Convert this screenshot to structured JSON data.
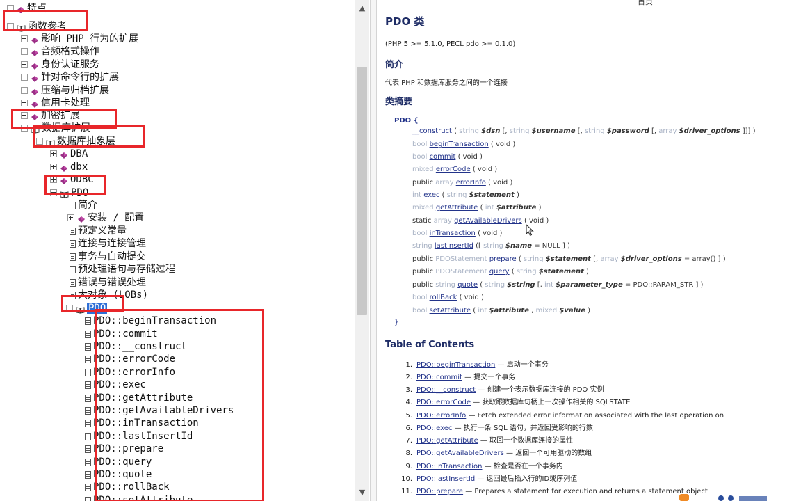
{
  "tree": {
    "nodes": [
      {
        "label": "特点",
        "icon": "book-icon",
        "expander": "plus"
      },
      {
        "label": "函数参考",
        "icon": "open-book-icon",
        "expander": "minus"
      },
      {
        "label": "影响 PHP 行为的扩展",
        "icon": "book-icon",
        "expander": "plus"
      },
      {
        "label": "音频格式操作",
        "icon": "book-icon",
        "expander": "plus"
      },
      {
        "label": "身份认证服务",
        "icon": "book-icon",
        "expander": "plus"
      },
      {
        "label": "针对命令行的扩展",
        "icon": "book-icon",
        "expander": "plus"
      },
      {
        "label": "压缩与归档扩展",
        "icon": "book-icon",
        "expander": "plus"
      },
      {
        "label": "信用卡处理",
        "icon": "book-icon",
        "expander": "plus"
      },
      {
        "label": "加密扩展",
        "icon": "book-icon",
        "expander": "plus"
      },
      {
        "label": "数据库扩展",
        "icon": "open-book-icon",
        "expander": "minus"
      },
      {
        "label": "数据库抽象层",
        "icon": "open-book-icon",
        "expander": "minus"
      },
      {
        "label": "DBA",
        "icon": "book-icon",
        "expander": "plus"
      },
      {
        "label": "dbx",
        "icon": "book-icon",
        "expander": "plus"
      },
      {
        "label": "ODBC",
        "icon": "book-icon",
        "expander": "plus"
      },
      {
        "label": "PDO",
        "icon": "open-book-icon",
        "expander": "minus"
      },
      {
        "label": "简介",
        "icon": "page-icon",
        "expander": ""
      },
      {
        "label": "安装 / 配置",
        "icon": "book-icon",
        "expander": "plus"
      },
      {
        "label": "预定义常量",
        "icon": "page-icon",
        "expander": ""
      },
      {
        "label": "连接与连接管理",
        "icon": "page-icon",
        "expander": ""
      },
      {
        "label": "事务与自动提交",
        "icon": "page-icon",
        "expander": ""
      },
      {
        "label": "预处理语句与存储过程",
        "icon": "page-icon",
        "expander": ""
      },
      {
        "label": "错误与错误处理",
        "icon": "page-icon",
        "expander": ""
      },
      {
        "label": "大对象 (LOBs)",
        "icon": "page-icon",
        "expander": ""
      },
      {
        "label": "PDO",
        "icon": "open-book-icon",
        "expander": "minus",
        "selected": true
      },
      {
        "label": "PDO::beginTransaction",
        "icon": "page-icon",
        "expander": ""
      },
      {
        "label": "PDO::commit",
        "icon": "page-icon",
        "expander": ""
      },
      {
        "label": "PDO::__construct",
        "icon": "page-icon",
        "expander": ""
      },
      {
        "label": "PDO::errorCode",
        "icon": "page-icon",
        "expander": ""
      },
      {
        "label": "PDO::errorInfo",
        "icon": "page-icon",
        "expander": ""
      },
      {
        "label": "PDO::exec",
        "icon": "page-icon",
        "expander": ""
      },
      {
        "label": "PDO::getAttribute",
        "icon": "page-icon",
        "expander": ""
      },
      {
        "label": "PDO::getAvailableDrivers",
        "icon": "page-icon",
        "expander": ""
      },
      {
        "label": "PDO::inTransaction",
        "icon": "page-icon",
        "expander": ""
      },
      {
        "label": "PDO::lastInsertId",
        "icon": "page-icon",
        "expander": ""
      },
      {
        "label": "PDO::prepare",
        "icon": "page-icon",
        "expander": ""
      },
      {
        "label": "PDO::query",
        "icon": "page-icon",
        "expander": ""
      },
      {
        "label": "PDO::quote",
        "icon": "page-icon",
        "expander": ""
      },
      {
        "label": "PDO::rollBack",
        "icon": "page-icon",
        "expander": ""
      },
      {
        "label": "PDO::setAttribute",
        "icon": "page-icon",
        "expander": ""
      }
    ],
    "highlight_color": "#e8262a",
    "selected_color": "#2f6fd6"
  },
  "doc": {
    "top_label": "首页",
    "title": "PDO 类",
    "version": "(PHP 5 >= 5.1.0, PECL pdo >= 0.1.0)",
    "intro_heading": "简介",
    "intro_text": "代表 PHP 和数据库服务之间的一个连接",
    "synopsis_heading": "类摘要",
    "class_open": "PDO {",
    "class_close": "}",
    "methods": [
      {
        "prefix": "",
        "type": "",
        "name": "__construct",
        "params": "( string $dsn [, string $username [, string $password [, array $driver_options ]]] )"
      },
      {
        "prefix": "",
        "type": "bool",
        "name": "beginTransaction",
        "params": "( void )"
      },
      {
        "prefix": "",
        "type": "bool",
        "name": "commit",
        "params": "( void )"
      },
      {
        "prefix": "",
        "type": "mixed",
        "name": "errorCode",
        "params": "( void )"
      },
      {
        "prefix": "public",
        "type": "array",
        "name": "errorInfo",
        "params": "( void )"
      },
      {
        "prefix": "",
        "type": "int",
        "name": "exec",
        "params": "( string $statement )"
      },
      {
        "prefix": "",
        "type": "mixed",
        "name": "getAttribute",
        "params": "( int $attribute )"
      },
      {
        "prefix": "static",
        "type": "array",
        "name": "getAvailableDrivers",
        "params": "( void )"
      },
      {
        "prefix": "",
        "type": "bool",
        "name": "inTransaction",
        "params": "( void )"
      },
      {
        "prefix": "",
        "type": "string",
        "name": "lastInsertId",
        "params": "([ string $name = NULL ] )"
      },
      {
        "prefix": "public",
        "type": "PDOStatement",
        "name": "prepare",
        "params": "( string $statement [, array $driver_options = array() ] )"
      },
      {
        "prefix": "public",
        "type": "PDOStatement",
        "name": "query",
        "params": "( string $statement )"
      },
      {
        "prefix": "public",
        "type": "string",
        "name": "quote",
        "params": "( string $string [, int $parameter_type = PDO::PARAM_STR ] )"
      },
      {
        "prefix": "",
        "type": "bool",
        "name": "rollBack",
        "params": "( void )"
      },
      {
        "prefix": "",
        "type": "bool",
        "name": "setAttribute",
        "params": "( int $attribute , mixed $value )"
      }
    ],
    "toc_heading": "Table of Contents",
    "toc": [
      {
        "num": "1.",
        "link": "PDO::beginTransaction",
        "desc": " — 启动一个事务"
      },
      {
        "num": "2.",
        "link": "PDO::commit",
        "desc": " — 提交一个事务"
      },
      {
        "num": "3.",
        "link": "PDO::__construct",
        "desc": " — 创建一个表示数据库连接的 PDO 实例"
      },
      {
        "num": "4.",
        "link": "PDO::errorCode",
        "desc": " — 获取跟数据库句柄上一次操作相关的 SQLSTATE"
      },
      {
        "num": "5.",
        "link": "PDO::errorInfo",
        "desc": " — Fetch extended error information associated with the last operation on"
      },
      {
        "num": "6.",
        "link": "PDO::exec",
        "desc": " — 执行一条 SQL 语句，并返回受影响的行数"
      },
      {
        "num": "7.",
        "link": "PDO::getAttribute",
        "desc": " — 取回一个数据库连接的属性"
      },
      {
        "num": "8.",
        "link": "PDO::getAvailableDrivers",
        "desc": " — 返回一个可用驱动的数组"
      },
      {
        "num": "9.",
        "link": "PDO::inTransaction",
        "desc": " — 检查是否在一个事务内"
      },
      {
        "num": "10.",
        "link": "PDO::lastInsertId",
        "desc": " — 返回最后插入行的ID或序列值"
      },
      {
        "num": "11.",
        "link": "PDO::prepare",
        "desc": " — Prepares a statement for execution and returns a statement object"
      }
    ]
  }
}
